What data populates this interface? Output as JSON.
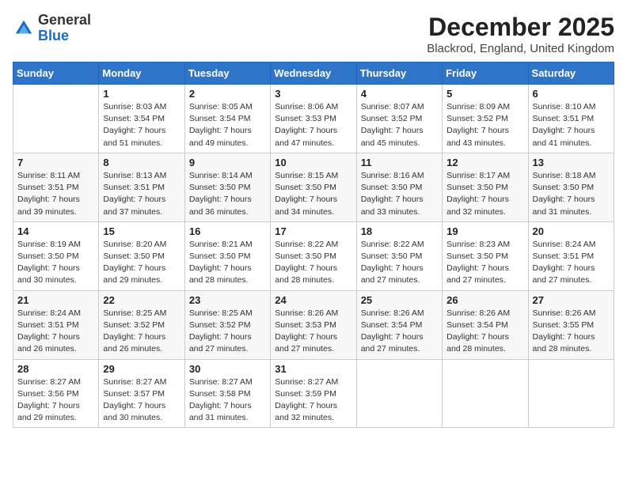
{
  "logo": {
    "general": "General",
    "blue": "Blue"
  },
  "header": {
    "title": "December 2025",
    "subtitle": "Blackrod, England, United Kingdom"
  },
  "days_of_week": [
    "Sunday",
    "Monday",
    "Tuesday",
    "Wednesday",
    "Thursday",
    "Friday",
    "Saturday"
  ],
  "weeks": [
    [
      {
        "day": "",
        "sunrise": "",
        "sunset": "",
        "daylight": ""
      },
      {
        "day": "1",
        "sunrise": "Sunrise: 8:03 AM",
        "sunset": "Sunset: 3:54 PM",
        "daylight": "Daylight: 7 hours and 51 minutes."
      },
      {
        "day": "2",
        "sunrise": "Sunrise: 8:05 AM",
        "sunset": "Sunset: 3:54 PM",
        "daylight": "Daylight: 7 hours and 49 minutes."
      },
      {
        "day": "3",
        "sunrise": "Sunrise: 8:06 AM",
        "sunset": "Sunset: 3:53 PM",
        "daylight": "Daylight: 7 hours and 47 minutes."
      },
      {
        "day": "4",
        "sunrise": "Sunrise: 8:07 AM",
        "sunset": "Sunset: 3:52 PM",
        "daylight": "Daylight: 7 hours and 45 minutes."
      },
      {
        "day": "5",
        "sunrise": "Sunrise: 8:09 AM",
        "sunset": "Sunset: 3:52 PM",
        "daylight": "Daylight: 7 hours and 43 minutes."
      },
      {
        "day": "6",
        "sunrise": "Sunrise: 8:10 AM",
        "sunset": "Sunset: 3:51 PM",
        "daylight": "Daylight: 7 hours and 41 minutes."
      }
    ],
    [
      {
        "day": "7",
        "sunrise": "Sunrise: 8:11 AM",
        "sunset": "Sunset: 3:51 PM",
        "daylight": "Daylight: 7 hours and 39 minutes."
      },
      {
        "day": "8",
        "sunrise": "Sunrise: 8:13 AM",
        "sunset": "Sunset: 3:51 PM",
        "daylight": "Daylight: 7 hours and 37 minutes."
      },
      {
        "day": "9",
        "sunrise": "Sunrise: 8:14 AM",
        "sunset": "Sunset: 3:50 PM",
        "daylight": "Daylight: 7 hours and 36 minutes."
      },
      {
        "day": "10",
        "sunrise": "Sunrise: 8:15 AM",
        "sunset": "Sunset: 3:50 PM",
        "daylight": "Daylight: 7 hours and 34 minutes."
      },
      {
        "day": "11",
        "sunrise": "Sunrise: 8:16 AM",
        "sunset": "Sunset: 3:50 PM",
        "daylight": "Daylight: 7 hours and 33 minutes."
      },
      {
        "day": "12",
        "sunrise": "Sunrise: 8:17 AM",
        "sunset": "Sunset: 3:50 PM",
        "daylight": "Daylight: 7 hours and 32 minutes."
      },
      {
        "day": "13",
        "sunrise": "Sunrise: 8:18 AM",
        "sunset": "Sunset: 3:50 PM",
        "daylight": "Daylight: 7 hours and 31 minutes."
      }
    ],
    [
      {
        "day": "14",
        "sunrise": "Sunrise: 8:19 AM",
        "sunset": "Sunset: 3:50 PM",
        "daylight": "Daylight: 7 hours and 30 minutes."
      },
      {
        "day": "15",
        "sunrise": "Sunrise: 8:20 AM",
        "sunset": "Sunset: 3:50 PM",
        "daylight": "Daylight: 7 hours and 29 minutes."
      },
      {
        "day": "16",
        "sunrise": "Sunrise: 8:21 AM",
        "sunset": "Sunset: 3:50 PM",
        "daylight": "Daylight: 7 hours and 28 minutes."
      },
      {
        "day": "17",
        "sunrise": "Sunrise: 8:22 AM",
        "sunset": "Sunset: 3:50 PM",
        "daylight": "Daylight: 7 hours and 28 minutes."
      },
      {
        "day": "18",
        "sunrise": "Sunrise: 8:22 AM",
        "sunset": "Sunset: 3:50 PM",
        "daylight": "Daylight: 7 hours and 27 minutes."
      },
      {
        "day": "19",
        "sunrise": "Sunrise: 8:23 AM",
        "sunset": "Sunset: 3:50 PM",
        "daylight": "Daylight: 7 hours and 27 minutes."
      },
      {
        "day": "20",
        "sunrise": "Sunrise: 8:24 AM",
        "sunset": "Sunset: 3:51 PM",
        "daylight": "Daylight: 7 hours and 27 minutes."
      }
    ],
    [
      {
        "day": "21",
        "sunrise": "Sunrise: 8:24 AM",
        "sunset": "Sunset: 3:51 PM",
        "daylight": "Daylight: 7 hours and 26 minutes."
      },
      {
        "day": "22",
        "sunrise": "Sunrise: 8:25 AM",
        "sunset": "Sunset: 3:52 PM",
        "daylight": "Daylight: 7 hours and 26 minutes."
      },
      {
        "day": "23",
        "sunrise": "Sunrise: 8:25 AM",
        "sunset": "Sunset: 3:52 PM",
        "daylight": "Daylight: 7 hours and 27 minutes."
      },
      {
        "day": "24",
        "sunrise": "Sunrise: 8:26 AM",
        "sunset": "Sunset: 3:53 PM",
        "daylight": "Daylight: 7 hours and 27 minutes."
      },
      {
        "day": "25",
        "sunrise": "Sunrise: 8:26 AM",
        "sunset": "Sunset: 3:54 PM",
        "daylight": "Daylight: 7 hours and 27 minutes."
      },
      {
        "day": "26",
        "sunrise": "Sunrise: 8:26 AM",
        "sunset": "Sunset: 3:54 PM",
        "daylight": "Daylight: 7 hours and 28 minutes."
      },
      {
        "day": "27",
        "sunrise": "Sunrise: 8:26 AM",
        "sunset": "Sunset: 3:55 PM",
        "daylight": "Daylight: 7 hours and 28 minutes."
      }
    ],
    [
      {
        "day": "28",
        "sunrise": "Sunrise: 8:27 AM",
        "sunset": "Sunset: 3:56 PM",
        "daylight": "Daylight: 7 hours and 29 minutes."
      },
      {
        "day": "29",
        "sunrise": "Sunrise: 8:27 AM",
        "sunset": "Sunset: 3:57 PM",
        "daylight": "Daylight: 7 hours and 30 minutes."
      },
      {
        "day": "30",
        "sunrise": "Sunrise: 8:27 AM",
        "sunset": "Sunset: 3:58 PM",
        "daylight": "Daylight: 7 hours and 31 minutes."
      },
      {
        "day": "31",
        "sunrise": "Sunrise: 8:27 AM",
        "sunset": "Sunset: 3:59 PM",
        "daylight": "Daylight: 7 hours and 32 minutes."
      },
      {
        "day": "",
        "sunrise": "",
        "sunset": "",
        "daylight": ""
      },
      {
        "day": "",
        "sunrise": "",
        "sunset": "",
        "daylight": ""
      },
      {
        "day": "",
        "sunrise": "",
        "sunset": "",
        "daylight": ""
      }
    ]
  ]
}
